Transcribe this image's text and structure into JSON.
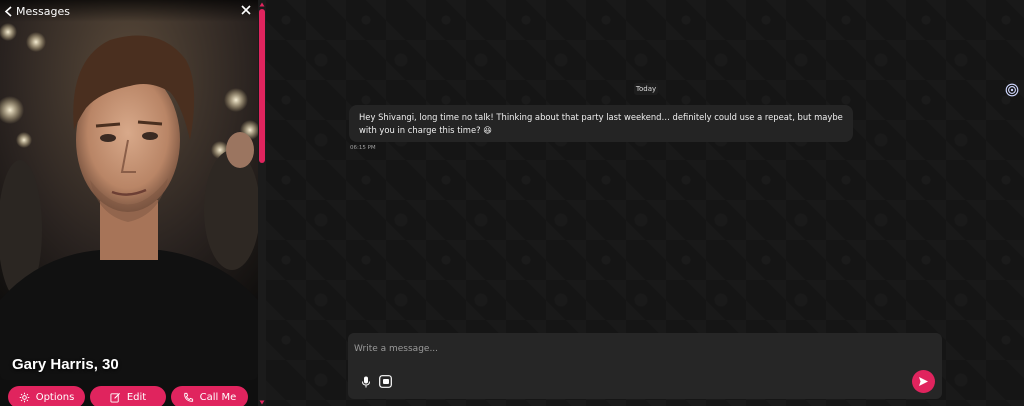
{
  "header": {
    "back_label": "Messages"
  },
  "profile": {
    "name": "Gary Harris, 30"
  },
  "actions": {
    "options_label": "Options",
    "edit_label": "Edit",
    "call_label": "Call Me"
  },
  "chat": {
    "date_divider": "Today",
    "messages": [
      {
        "text": "Hey Shivangi, long time no talk! Thinking about that party last weekend… definitely could use a repeat, but maybe with you in charge this time? 😆",
        "time": "06:15 PM"
      }
    ]
  },
  "composer": {
    "placeholder": "Write a message..."
  },
  "colors": {
    "accent": "#e0245e",
    "background": "#151515",
    "bubble": "#242424"
  },
  "icons": {
    "back": "chevron-left-icon",
    "close": "close-icon",
    "options": "gear-icon",
    "edit": "edit-icon",
    "call": "phone-icon",
    "side": "spiral-icon",
    "mic": "microphone-icon",
    "media": "image-icon",
    "send": "send-icon"
  }
}
